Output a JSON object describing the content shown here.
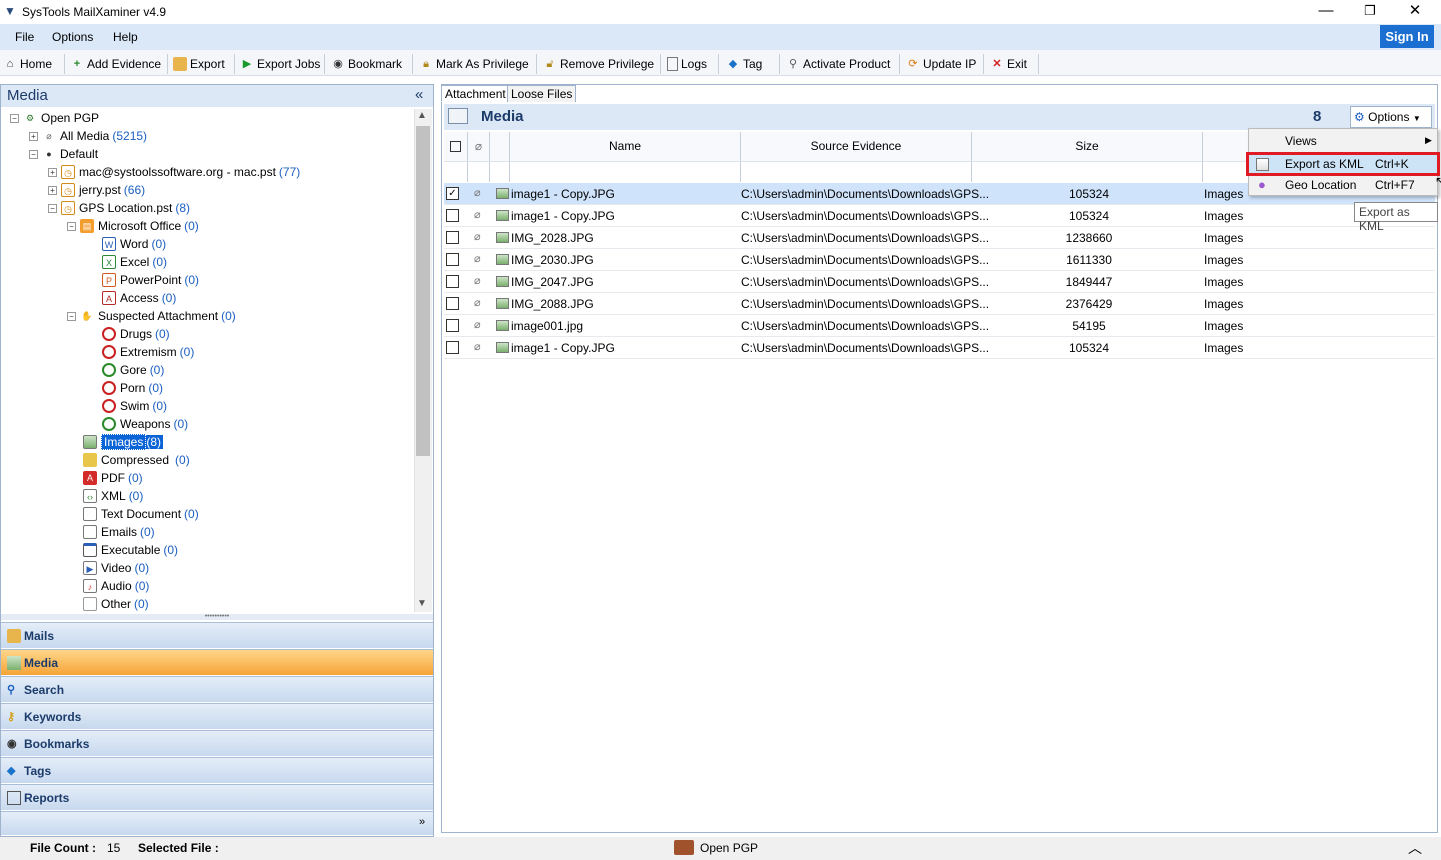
{
  "window": {
    "title": "SysTools MailXaminer v4.9"
  },
  "menubar": {
    "file": "File",
    "options": "Options",
    "help": "Help",
    "signin": "Sign In"
  },
  "toolbar": {
    "home": "Home",
    "add_evidence": "Add Evidence",
    "export": "Export",
    "export_jobs": "Export Jobs",
    "bookmark": "Bookmark",
    "mark_privilege": "Mark As Privilege",
    "remove_privilege": "Remove Privilege",
    "logs": "Logs",
    "tag": "Tag",
    "activate": "Activate Product",
    "update_ip": "Update IP",
    "exit": "Exit"
  },
  "left": {
    "title": "Media",
    "collapse": "«",
    "tree": [
      {
        "label": "Open PGP",
        "count": ""
      },
      {
        "label": "All Media",
        "count": "(5215)"
      },
      {
        "label": "Default",
        "count": ""
      },
      {
        "label": "mac@systoolssoftware.org - mac.pst",
        "count": "(77)"
      },
      {
        "label": "jerry.pst",
        "count": "(66)"
      },
      {
        "label": "GPS Location.pst",
        "count": "(8)"
      },
      {
        "label": "Microsoft Office",
        "count": "(0)"
      },
      {
        "label": "Word",
        "count": "(0)"
      },
      {
        "label": "Excel",
        "count": "(0)"
      },
      {
        "label": "PowerPoint",
        "count": "(0)"
      },
      {
        "label": "Access",
        "count": "(0)"
      },
      {
        "label": "Suspected Attachment",
        "count": "(0)"
      },
      {
        "label": "Drugs",
        "count": "(0)"
      },
      {
        "label": "Extremism",
        "count": "(0)"
      },
      {
        "label": "Gore",
        "count": "(0)"
      },
      {
        "label": "Porn",
        "count": "(0)"
      },
      {
        "label": "Swim",
        "count": "(0)"
      },
      {
        "label": "Weapons",
        "count": "(0)"
      },
      {
        "label": "Images",
        "count": "(8)"
      },
      {
        "label": "Compressed",
        "count": "(0)"
      },
      {
        "label": "PDF",
        "count": "(0)"
      },
      {
        "label": "XML",
        "count": "(0)"
      },
      {
        "label": "Text Document",
        "count": "(0)"
      },
      {
        "label": "Emails",
        "count": "(0)"
      },
      {
        "label": "Executable",
        "count": "(0)"
      },
      {
        "label": "Video",
        "count": "(0)"
      },
      {
        "label": "Audio",
        "count": "(0)"
      },
      {
        "label": "Other",
        "count": "(0)"
      }
    ],
    "nav": [
      "Mails",
      "Media",
      "Search",
      "Keywords",
      "Bookmarks",
      "Tags",
      "Reports"
    ]
  },
  "right": {
    "tabs": [
      "Attachment",
      "Loose Files"
    ],
    "header": {
      "title": "Media",
      "count": "8",
      "options": "Options"
    },
    "columns": {
      "name": "Name",
      "source": "Source Evidence",
      "size": "Size"
    },
    "rows": [
      {
        "name": "image1 - Copy.JPG",
        "src": "C:\\Users\\admin\\Documents\\Downloads\\GPS...",
        "size": "105324",
        "type": "Images"
      },
      {
        "name": "image1 - Copy.JPG",
        "src": "C:\\Users\\admin\\Documents\\Downloads\\GPS...",
        "size": "105324",
        "type": "Images"
      },
      {
        "name": "IMG_2028.JPG",
        "src": "C:\\Users\\admin\\Documents\\Downloads\\GPS...",
        "size": "1238660",
        "type": "Images"
      },
      {
        "name": "IMG_2030.JPG",
        "src": "C:\\Users\\admin\\Documents\\Downloads\\GPS...",
        "size": "1611330",
        "type": "Images"
      },
      {
        "name": "IMG_2047.JPG",
        "src": "C:\\Users\\admin\\Documents\\Downloads\\GPS...",
        "size": "1849447",
        "type": "Images"
      },
      {
        "name": "IMG_2088.JPG",
        "src": "C:\\Users\\admin\\Documents\\Downloads\\GPS...",
        "size": "2376429",
        "type": "Images"
      },
      {
        "name": "image001.jpg",
        "src": "C:\\Users\\admin\\Documents\\Downloads\\GPS...",
        "size": "54195",
        "type": "Images"
      },
      {
        "name": "image1 - Copy.JPG",
        "src": "C:\\Users\\admin\\Documents\\Downloads\\GPS...",
        "size": "105324",
        "type": "Images"
      }
    ],
    "menu": {
      "views": "Views",
      "export_kml": "Export as KML",
      "export_kml_key": "Ctrl+K",
      "geo": "Geo Location",
      "geo_key": "Ctrl+F7"
    },
    "tooltip": "Export as KML"
  },
  "status": {
    "file_count_label": "File Count :",
    "file_count": "15",
    "selected_label": "Selected File :",
    "center": "Open PGP"
  }
}
